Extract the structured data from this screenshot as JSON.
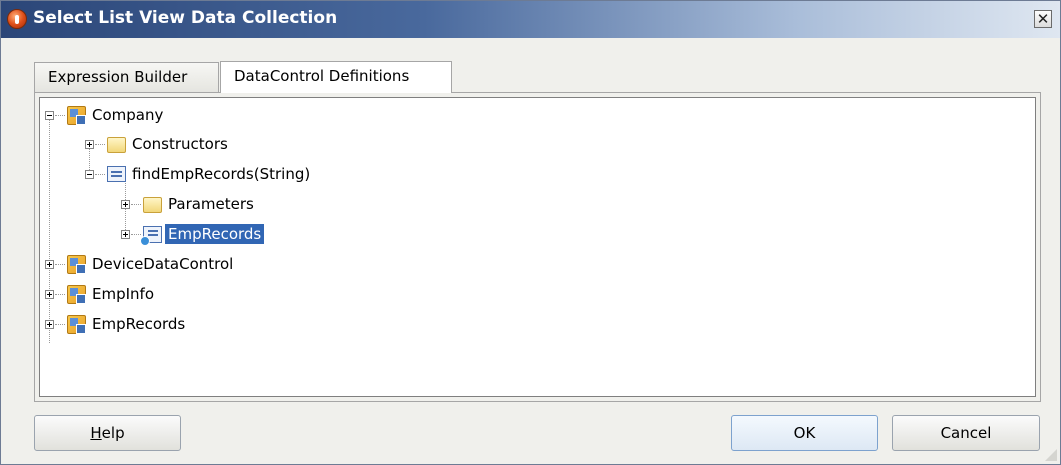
{
  "window": {
    "title": "Select List View Data Collection",
    "close_glyph": "✕"
  },
  "tabs": [
    {
      "label": "Expression Builder",
      "active": false
    },
    {
      "label": "DataControl Definitions",
      "active": true
    }
  ],
  "tree": [
    {
      "label": "Company",
      "icon": "data-control-icon",
      "expanded": true,
      "level": 0
    },
    {
      "label": "Constructors",
      "icon": "folder-icon",
      "expanded": false,
      "level": 1
    },
    {
      "label": "findEmpRecords(String)",
      "icon": "method-icon",
      "expanded": true,
      "level": 1
    },
    {
      "label": "Parameters",
      "icon": "folder-icon",
      "expanded": false,
      "level": 2
    },
    {
      "label": "EmpRecords",
      "icon": "collection-icon",
      "expanded": false,
      "level": 2,
      "selected": true
    },
    {
      "label": "DeviceDataControl",
      "icon": "data-control-icon",
      "expanded": false,
      "level": 0
    },
    {
      "label": "EmpInfo",
      "icon": "data-control-icon",
      "expanded": false,
      "level": 0
    },
    {
      "label": "EmpRecords",
      "icon": "data-control-icon",
      "expanded": false,
      "level": 0
    }
  ],
  "buttons": {
    "help_mnemonic": "H",
    "help_rest": "elp",
    "ok": "OK",
    "cancel": "Cancel"
  },
  "colors": {
    "selection": "#3166b4",
    "title_gradient_start": "#2b4678"
  }
}
